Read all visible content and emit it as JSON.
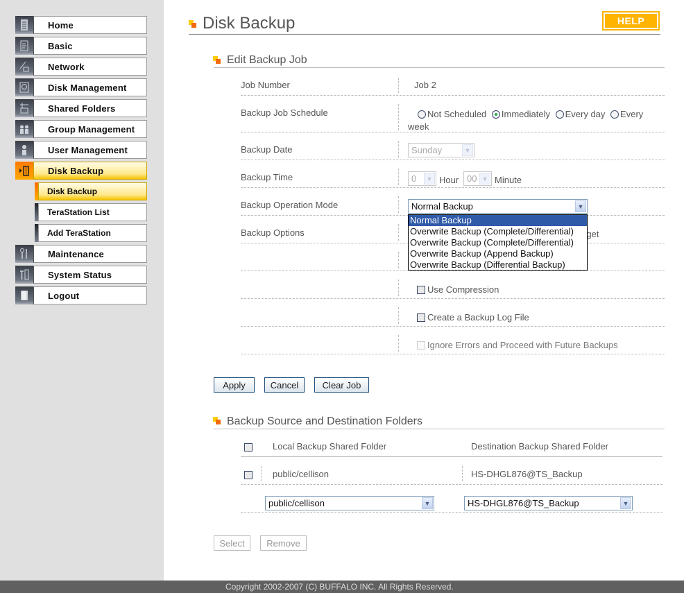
{
  "sidebar": {
    "items": [
      {
        "label": "Home",
        "icon": "home-icon"
      },
      {
        "label": "Basic",
        "icon": "basic-settings-icon"
      },
      {
        "label": "Network",
        "icon": "network-icon"
      },
      {
        "label": "Disk Management",
        "icon": "disk-icon"
      },
      {
        "label": "Shared Folders",
        "icon": "shared-folder-icon"
      },
      {
        "label": "Group Management",
        "icon": "group-icon"
      },
      {
        "label": "User Management",
        "icon": "user-icon"
      },
      {
        "label": "Disk Backup",
        "icon": "backup-icon",
        "active": true
      },
      {
        "label": "Maintenance",
        "icon": "maintenance-icon"
      },
      {
        "label": "System Status",
        "icon": "system-status-icon"
      },
      {
        "label": "Logout",
        "icon": "logout-icon"
      }
    ],
    "sub_items": [
      {
        "label": "Disk Backup",
        "active": true
      },
      {
        "label": "TeraStation List"
      },
      {
        "label": "Add TeraStation"
      }
    ]
  },
  "header": {
    "title": "Disk Backup",
    "help_label": "HELP"
  },
  "edit_job": {
    "section_title": "Edit Backup Job",
    "job_number": {
      "label": "Job Number",
      "value": "Job 2"
    },
    "schedule": {
      "label": "Backup Job Schedule",
      "options": [
        "Not Scheduled",
        "Immediately",
        "Every day",
        "Every",
        "week"
      ],
      "selected": "Immediately"
    },
    "date": {
      "label": "Backup Date",
      "value": "Sunday"
    },
    "time": {
      "label": "Backup Time",
      "hour": "0",
      "hour_label": "Hour",
      "minute": "00",
      "minute_label": "Minute"
    },
    "mode": {
      "label": "Backup Operation Mode",
      "value": "Normal Backup",
      "options": [
        "Normal Backup",
        "Overwrite Backup (Complete/Differential)",
        "Overwrite Backup (Complete/Differential)",
        "Overwrite Backup (Append Backup)",
        "Overwrite Backup (Differential Backup)"
      ]
    },
    "options": {
      "label": "Backup Options",
      "hidden_text_fragment": "rget",
      "use_compression": "Use Compression",
      "create_log": "Create a Backup Log File",
      "ignore_errors": "Ignore Errors and Proceed with Future Backups"
    },
    "buttons": {
      "apply": "Apply",
      "cancel": "Cancel",
      "clear": "Clear Job"
    }
  },
  "folders": {
    "section_title": "Backup Source and Destination Folders",
    "headers": {
      "local": "Local Backup Shared Folder",
      "destination": "Destination Backup Shared Folder"
    },
    "rows": [
      {
        "local": "public/cellison",
        "destination": "HS-DHGL876@TS_Backup"
      }
    ],
    "select_local": "public/cellison",
    "select_destination": "HS-DHGL876@TS_Backup",
    "buttons": {
      "select": "Select",
      "remove": "Remove"
    }
  },
  "footer": {
    "copyright": "Copyright 2002-2007 (C) BUFFALO INC. All Rights Reserved."
  }
}
